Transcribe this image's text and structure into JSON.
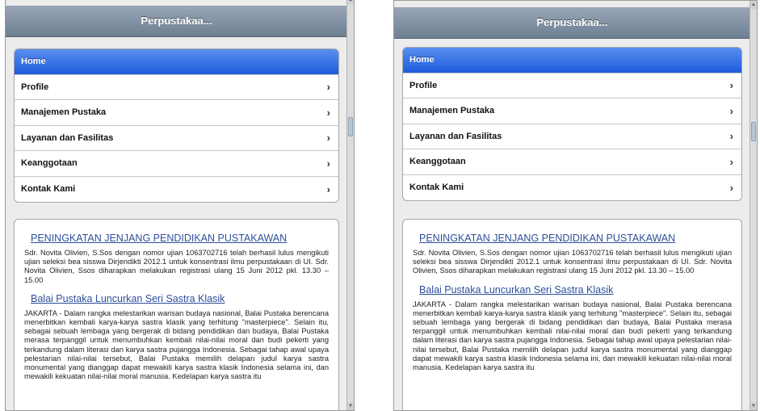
{
  "app_title": "Perpustakaa...",
  "menu": [
    {
      "label": "Home",
      "active": true
    },
    {
      "label": "Profile",
      "active": false
    },
    {
      "label": "Manajemen Pustaka",
      "active": false
    },
    {
      "label": "Layanan dan Fasilitas",
      "active": false
    },
    {
      "label": "Keanggotaan",
      "active": false
    },
    {
      "label": "Kontak Kami",
      "active": false
    }
  ],
  "chevron": "›",
  "articles": [
    {
      "title": "PENINGKATAN JENJANG PENDIDIKAN PUSTAKAWAN",
      "body": "Sdr. Novita Olivien, S.Sos dengan nomor ujian 1063702716 telah berhasil lulus mengikuti ujian seleksi bea sisswa Dirjendikti 2012.1 untuk konsentrasi ilmu perpustakaan di UI. Sdr. Novita Olivien, Ssos diharapkan melakukan registrasi ulang 15 Juni 2012 pkl. 13.30 – 15.00"
    },
    {
      "title": "Balai Pustaka Luncurkan Seri Sastra Klasik",
      "body": "JAKARTA - Dalam rangka melestarikan warisan budaya nasional, Balai Pustaka berencana menerbitkan kembali karya-karya sastra klasik yang terhitung \"masterpiece\". Selain itu, sebagai sebuah lembaga yang bergerak di bidang pendidikan dan budaya, Balai Pustaka merasa terpanggil untuk menumbuhkan kembali nilai-nilai moral dan budi pekerti yang terkandung dalam literasi dan karya sastra pujangga Indonesia. Sebagai tahap awal upaya pelestarian nilai-nilai tersebut, Balai Pustaka memilih delapan judul karya sastra monumental yang dianggap dapat mewakili karya sastra klasik Indonesia selama ini, dan mewakili kekuatan nilai-nilai moral manusia. Kedelapan karya sastra itu"
    }
  ],
  "colors": {
    "titlebar": "#7d8ea1",
    "active_item": "#2a66e0",
    "article_link": "#2d4f9a"
  }
}
